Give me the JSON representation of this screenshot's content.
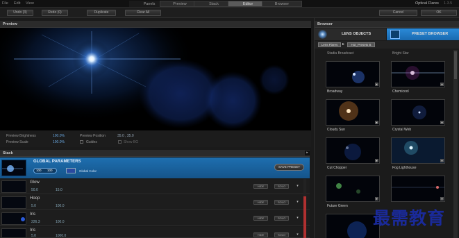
{
  "menu": {
    "items": [
      "File",
      "Edit",
      "View"
    ]
  },
  "modes": {
    "tabs": [
      "Panels",
      "Preview",
      "Stack",
      "Editor",
      "Browser"
    ],
    "active": "Editor"
  },
  "app": {
    "title": "Optical Flares",
    "version": "1.3.5"
  },
  "toolbar": {
    "undo_label": "Undo (3)",
    "redo_label": "Redo (0)",
    "duplicate_label": "Duplicate",
    "clear_all_label": "Clear All",
    "cancel_label": "Cancel",
    "ok_label": "OK"
  },
  "preview": {
    "title": "Preview",
    "brightness_label": "Preview Brightness",
    "brightness_value": "100.0%",
    "scale_label": "Preview Scale",
    "scale_value": "100.0%",
    "position_label": "Preview Position",
    "position_value": "35.0 , 35.0",
    "guides_label": "Guides",
    "show_bg_label": "Show BG"
  },
  "stack": {
    "title": "Stack",
    "global": {
      "title": "GLOBAL PARAMETERS",
      "pill_a": "100",
      "pill_b": "100",
      "color_label": "Global Color",
      "save_preset": "SAVE PRESET"
    },
    "hide_label": "HIDE",
    "solo_label": "SOLO",
    "rows": [
      {
        "name": "Glow",
        "p1": "50.0",
        "p2": "15.0"
      },
      {
        "name": "Hoop",
        "p1": "5.0",
        "p2": "100.0"
      },
      {
        "name": "Iris",
        "p1": "226.3",
        "p2": "100.0"
      },
      {
        "name": "Iris",
        "p1": "5.0",
        "p2": "1000.0"
      }
    ]
  },
  "browser": {
    "title": "Browser",
    "tab_lens": "LENS OBJECTS",
    "tab_preset": "PRESET BROWSER",
    "crumb_1": "Lens Flares",
    "crumb_2": "Hot_Presets B",
    "top_row": [
      "Stadia Broadcast",
      "Bright Star"
    ],
    "presets": [
      "Broadway",
      "Chemicool",
      "Cloudy Sun",
      "Crystal Web",
      "Cut Chopper",
      "Fog Lighthouse",
      "Future Green",
      ""
    ]
  },
  "watermark": "最需教育"
}
